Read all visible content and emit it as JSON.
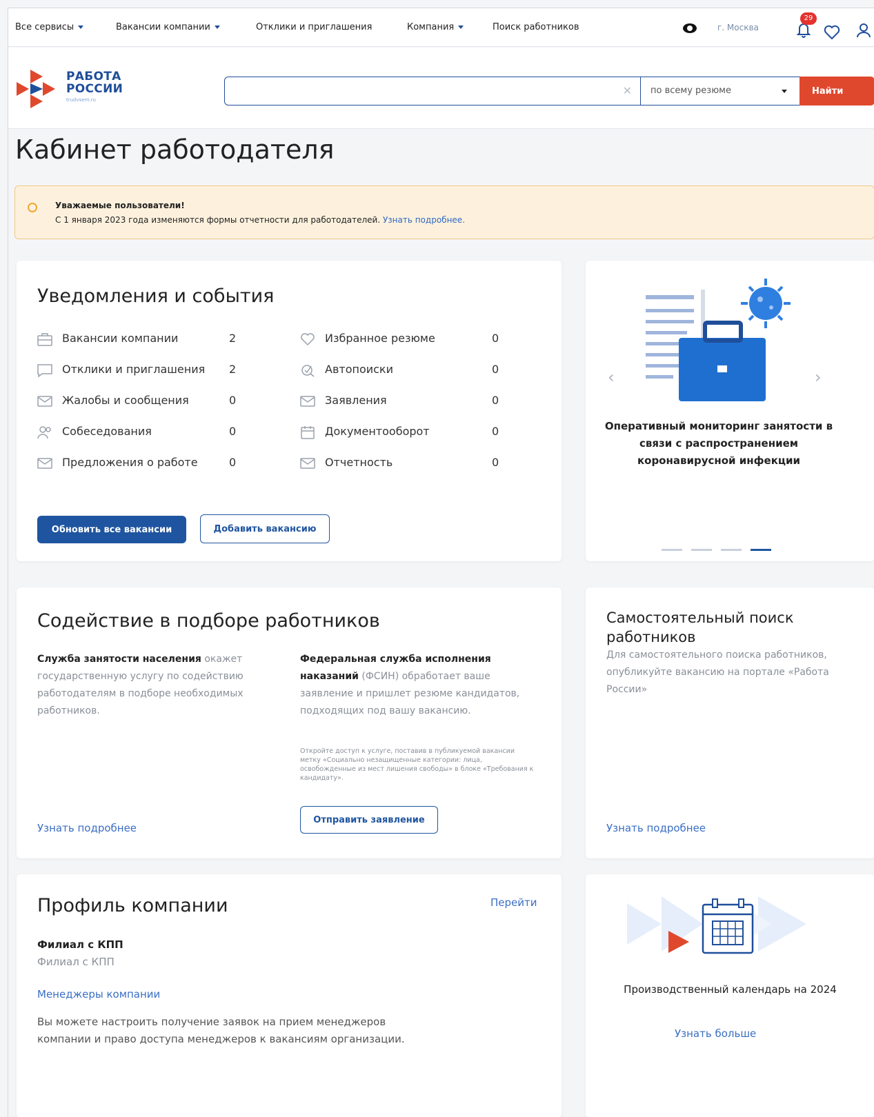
{
  "topnav": {
    "items": [
      {
        "label": "Все сервисы",
        "dropdown": true
      },
      {
        "label": "Вакансии компании",
        "dropdown": true
      },
      {
        "label": "Отклики и приглашения",
        "dropdown": false
      },
      {
        "label": "Компания",
        "dropdown": true
      },
      {
        "label": "Поиск работников",
        "dropdown": false
      }
    ],
    "city": "г. Москва",
    "notifications_count": "29"
  },
  "header": {
    "logo_line1": "РАБОТА",
    "logo_line2": "РОССИИ",
    "logo_sub": "trudvsem.ru",
    "search_value": "",
    "search_scope": "по всему резюме",
    "search_button": "Найти"
  },
  "page": {
    "title": "Кабинет работодателя"
  },
  "alert": {
    "title": "Уважаемые пользователи!",
    "text": "С 1 января 2023 года изменяются формы отчетности для работодателей.",
    "link": "Узнать подробнее."
  },
  "notifications": {
    "title": "Уведомления и события",
    "left": [
      {
        "icon": "briefcase-icon",
        "label": "Вакансии компании",
        "count": "2"
      },
      {
        "icon": "chat-icon",
        "label": "Отклики и приглашения",
        "count": "2"
      },
      {
        "icon": "mail-icon",
        "label": "Жалобы и сообщения",
        "count": "0"
      },
      {
        "icon": "people-icon",
        "label": "Собеседования",
        "count": "0"
      },
      {
        "icon": "mail-icon",
        "label": "Предложения о работе",
        "count": "0"
      }
    ],
    "right": [
      {
        "icon": "heart-icon",
        "label": "Избранное резюме",
        "count": "0"
      },
      {
        "icon": "autosearch-icon",
        "label": "Автопоиски",
        "count": "0"
      },
      {
        "icon": "mail-icon",
        "label": "Заявления",
        "count": "0"
      },
      {
        "icon": "calendar-icon",
        "label": "Документооборот",
        "count": "0"
      },
      {
        "icon": "mail-icon",
        "label": "Отчетность",
        "count": "0"
      }
    ],
    "btn_update": "Обновить все вакансии",
    "btn_add": "Добавить вакансию"
  },
  "carousel": {
    "caption": "Оперативный мониторинг занятости в связи с распространением коронавирусной инфекции",
    "dots": 4,
    "active_dot": 4
  },
  "assist": {
    "title": "Содействие в подборе работников",
    "col1_bold": "Служба занятости населения",
    "col1_text": " окажет государственную услугу по содействию работодателям в подборе необходимых работников.",
    "col1_link": "Узнать подробнее",
    "col2_bold": "Федеральная служба исполнения наказаний",
    "col2_text": " (ФСИН) обработает ваше заявление и пришлет резюме кандидатов, подходящих под вашу вакансию.",
    "col2_note": "Откройте доступ к услуге, поставив в публикуемой вакансии метку «Социально незащищенные категории: лица, освобожденные из мест лишения свободы» в блоке «Требования к кандидату».",
    "col2_button": "Отправить заявление"
  },
  "selfsearch": {
    "title": "Самостоятельный поиск работников",
    "text": "Для самостоятельного поиска работников, опубликуйте вакансию на портале «Работа России»",
    "link": "Узнать подробнее"
  },
  "profile": {
    "title": "Профиль компании",
    "go_link": "Перейти",
    "name_bold": "Филиал с КПП",
    "name_sub": "Филиал с КПП",
    "managers_link": "Менеджеры компании",
    "text": "Вы можете настроить получение заявок на прием менеджеров компании и право доступа менеджеров к вакансиям организации."
  },
  "calendar": {
    "caption": "Производственный календарь на 2024",
    "link": "Узнать больше"
  },
  "colors": {
    "brand_blue": "#1f55a0",
    "accent_red": "#e0482e",
    "alert_bg": "#fdf1dd"
  }
}
